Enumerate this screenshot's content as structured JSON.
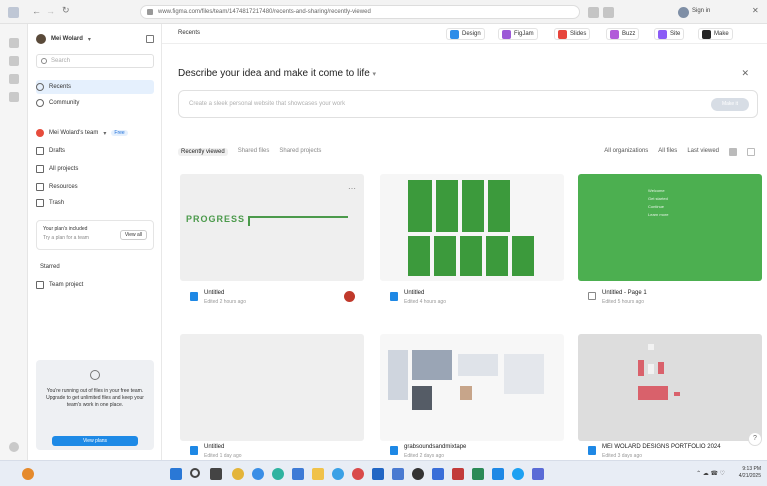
{
  "browser": {
    "url": "www.figma.com/files/team/1474817217480/recents-and-sharing/recently-viewed",
    "profile_label": "Sign in"
  },
  "sidebar": {
    "account_name": "Mei Wolard",
    "search_placeholder": "Search",
    "items": [
      {
        "label": "Recents",
        "icon": "clock-icon"
      },
      {
        "label": "Community",
        "icon": "globe-icon"
      }
    ],
    "team_name": "Mei Wolard's team",
    "team_badge": "Free",
    "team_items": [
      {
        "label": "Drafts"
      },
      {
        "label": "All projects"
      },
      {
        "label": "Resources"
      },
      {
        "label": "Trash"
      }
    ],
    "upgrade_title": "Your plan's included",
    "upgrade_sub": "Try a plan for a team",
    "upgrade_button": "View all",
    "starred_heading": "Starred",
    "starred_item": "Team project",
    "storage_text": "You're running out of files in your free team. Upgrade to get unlimited files and keep your team's work in one place.",
    "storage_button": "View plans"
  },
  "topbar": {
    "title": "Recents",
    "chips": [
      {
        "label": "Design",
        "color": "#2d8ce8"
      },
      {
        "label": "FigJam",
        "color": "#9b59d6"
      },
      {
        "label": "Slides",
        "color": "#e7443b"
      },
      {
        "label": "Buzz",
        "color": "#b15ad9"
      },
      {
        "label": "Site",
        "color": "#8b5cf6"
      },
      {
        "label": "Make",
        "color": "#222222"
      }
    ]
  },
  "prompt": {
    "title": "Describe your idea and make it come to life",
    "placeholder": "Create a sleek personal website that showcases your work",
    "send_label": "Make it"
  },
  "tabs": [
    "Recently viewed",
    "Shared files",
    "Shared projects"
  ],
  "filters": [
    "All organizations",
    "All files",
    "Last viewed"
  ],
  "files": [
    {
      "name": "Untitled",
      "meta": "Edited 2 hours ago"
    },
    {
      "name": "Untitled",
      "meta": "Edited 4 hours ago"
    },
    {
      "name": "Untitled - Page 1",
      "meta": "Edited 5 hours ago"
    },
    {
      "name": "Untitled",
      "meta": "Edited 1 day ago"
    },
    {
      "name": "grabsoundsandmixtape",
      "meta": "Edited 2 days ago"
    },
    {
      "name": "MEI WOLARD DESIGNS PORTFOLIO 2024",
      "meta": "Edited 3 days ago"
    }
  ],
  "thumb1_text": "PROGRESS",
  "thumb3_lines": [
    "Welcome",
    "Get started",
    "Continue",
    "Learn more"
  ],
  "taskbar": {
    "time": "9:13 PM",
    "date": "4/21/2025"
  }
}
